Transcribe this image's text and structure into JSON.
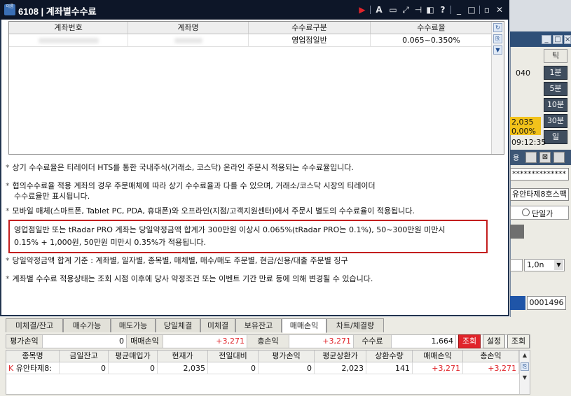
{
  "window": {
    "title": "6108 | 계좌별수수료",
    "logo": "이름"
  },
  "grid": {
    "columns": [
      "계좌번호",
      "계좌명",
      "수수료구분",
      "수수료율"
    ],
    "rows": [
      {
        "type": "영업점일반",
        "rate": "0.065~0.350%"
      }
    ]
  },
  "notes": [
    "상기 수수료율은 티레이더 HTS를 통한 국내주식(거래소, 코스닥) 온라인 주문시 적용되는 수수료율입니다.",
    "협의수수료율 적용 계좌의 경우 주문매체에 따라 상기 수수료율과 다를 수 있으며, 거래소/코스닥 시장의 티레이더",
    "수수료율만 표시됩니다.",
    "모바일 매체(스마트폰, Tablet PC, PDA, 휴대폰)와 오프라인(지점/고객지원센터)에서 주문시 별도의 수수료율이 적용됩니다.",
    "영업점일반 또는 tRadar PRO 계좌는 당일약정금액 합계가 300만원 이상시 0.065%(tRadar PRO는 0.1%), 50~300만원 미만시",
    "0.15% + 1,000원, 50만원 미만시 0.35%가 적용됩니다.",
    "당일약정금액 합계 기준 : 계좌별, 일자별, 종목별, 매체별, 매수/매도 주문별, 현금/신용/대출 주문별 징구",
    "계좌별 수수료 적용상태는 조회 시점 이후에 당사 약정조건 또는 이벤트 기간 만료 등에 의해 변경될 수 있습니다."
  ],
  "background": {
    "buttons": [
      "틱",
      "1분",
      "5분",
      "10분",
      "30분",
      "일"
    ],
    "texts": {
      "t040": "040",
      "price": "2,035",
      "pct": "0,00%",
      "time": "09:12:35",
      "pwd": "**************",
      "stock": "유안타제8호스팩",
      "radio": "단일가",
      "qty": "1,0n",
      "order_no": "0001496"
    }
  },
  "tabs": [
    "미체결/잔고",
    "매수가능",
    "매도가능",
    "당일체결",
    "미체결",
    "보유잔고",
    "매매손익",
    "차트/체결량"
  ],
  "active_tab": "매매손익",
  "summary": {
    "l1": "평가손익",
    "v1": "0",
    "l2": "매매손익",
    "v2": "+3,271",
    "l3": "총손익",
    "v3": "+3,271",
    "l4": "수수료",
    "v4": "1,664"
  },
  "summary_buttons": [
    "조회",
    "설정",
    "조회"
  ],
  "table": {
    "columns": [
      "종목명",
      "금일잔고",
      "평균매입가",
      "현재가",
      "전일대비",
      "평가손익",
      "평균상환가",
      "상환수량",
      "매매손익",
      "총손익"
    ],
    "row": {
      "k": "K",
      "name": "유안타제8:",
      "bal": "0",
      "avg": "0",
      "cur": "2,035",
      "chg": "0",
      "eval": "0",
      "avgr": "2,023",
      "qty": "141",
      "trade": "+3,271",
      "total": "+3,271"
    }
  }
}
